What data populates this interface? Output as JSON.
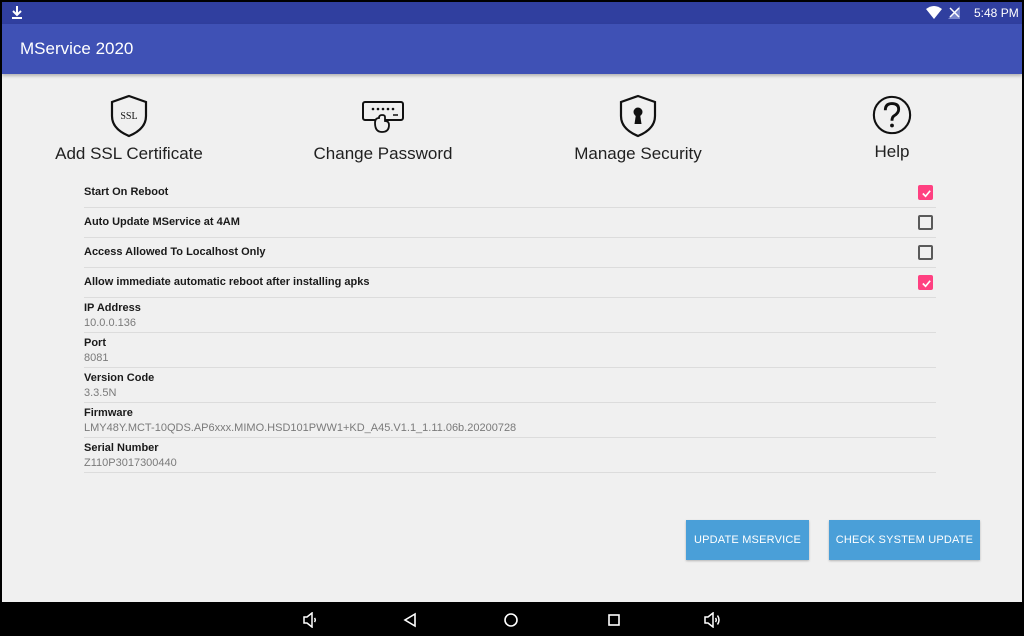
{
  "status_bar": {
    "time": "5:48 PM",
    "icons": [
      "download-icon",
      "wifi-icon",
      "no-signal-icon"
    ]
  },
  "app_bar": {
    "title": "MService 2020"
  },
  "tiles": [
    {
      "label": "Add SSL Certificate",
      "icon": "ssl-shield-icon",
      "icon_text": "SSL"
    },
    {
      "label": "Change Password",
      "icon": "password-keypad-icon"
    },
    {
      "label": "Manage Security",
      "icon": "lock-shield-icon"
    },
    {
      "label": "Help",
      "icon": "question-icon"
    }
  ],
  "checks": [
    {
      "label": "Start On Reboot",
      "checked": true
    },
    {
      "label": "Auto Update MService at 4AM",
      "checked": false
    },
    {
      "label": "Access Allowed To Localhost Only",
      "checked": false
    },
    {
      "label": "Allow immediate automatic reboot after installing apks",
      "checked": true
    }
  ],
  "info": [
    {
      "key": "IP Address",
      "value": "10.0.0.136"
    },
    {
      "key": "Port",
      "value": "8081"
    },
    {
      "key": "Version Code",
      "value": "3.3.5N"
    },
    {
      "key": "Firmware",
      "value": "LMY48Y.MCT-10QDS.AP6xxx.MIMO.HSD101PWW1+KD_A45.V1.1_1.11.06b.20200728"
    },
    {
      "key": "Serial Number",
      "value": "Z110P3017300440"
    }
  ],
  "buttons": {
    "update": "UPDATE MSERVICE",
    "check_system": "CHECK SYSTEM UPDATE"
  },
  "nav": [
    "volume-down-icon",
    "back-icon",
    "home-icon",
    "recents-icon",
    "volume-up-icon"
  ],
  "colors": {
    "status_bar": "#303f9f",
    "app_bar": "#3f51b5",
    "accent": "#ff4081",
    "button": "#4a9fd8"
  }
}
